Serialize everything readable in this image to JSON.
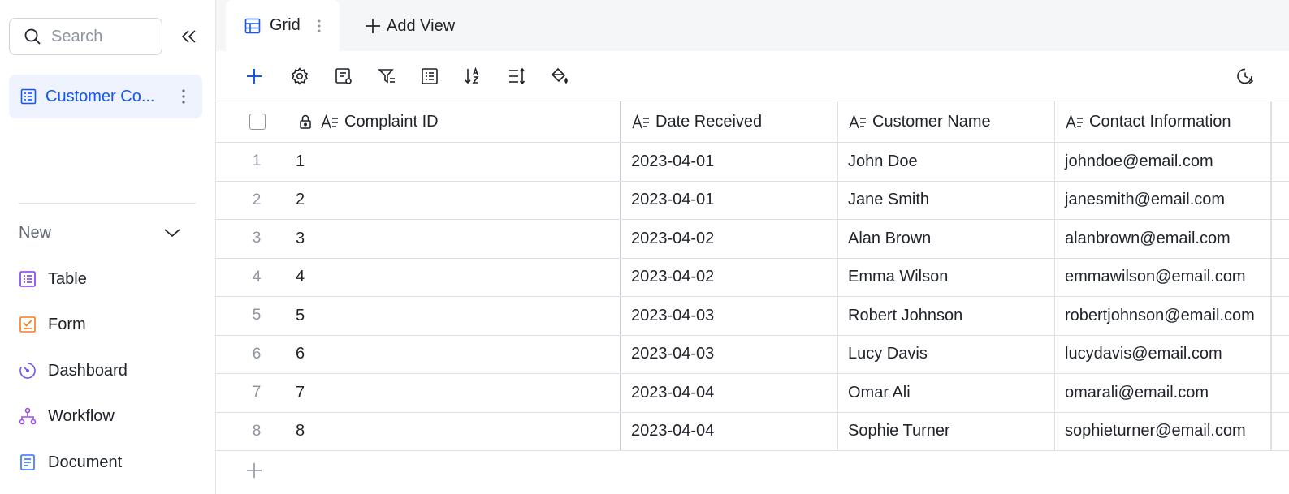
{
  "sidebar": {
    "search_placeholder": "Search",
    "active_item": "Customer Co...",
    "new_label": "New",
    "nav": [
      {
        "label": "Table",
        "icon": "table-icon",
        "color": "#7f3bf5"
      },
      {
        "label": "Form",
        "icon": "form-icon",
        "color": "#f57a1e"
      },
      {
        "label": "Dashboard",
        "icon": "dashboard-icon",
        "color": "#6c5ae8"
      },
      {
        "label": "Workflow",
        "icon": "workflow-icon",
        "color": "#9b4ae6"
      },
      {
        "label": "Document",
        "icon": "document-icon",
        "color": "#3370ff"
      }
    ]
  },
  "tabs": {
    "grid_label": "Grid",
    "add_view_label": "Add View"
  },
  "columns": [
    "Complaint ID",
    "Date Received",
    "Customer Name",
    "Contact Information"
  ],
  "rows": [
    {
      "num": "1",
      "id": "1",
      "date": "2023-04-01",
      "name": "John Doe",
      "contact": "johndoe@email.com"
    },
    {
      "num": "2",
      "id": "2",
      "date": "2023-04-01",
      "name": "Jane Smith",
      "contact": "janesmith@email.com"
    },
    {
      "num": "3",
      "id": "3",
      "date": "2023-04-02",
      "name": "Alan Brown",
      "contact": "alanbrown@email.com"
    },
    {
      "num": "4",
      "id": "4",
      "date": "2023-04-02",
      "name": "Emma Wilson",
      "contact": "emmawilson@email.com"
    },
    {
      "num": "5",
      "id": "5",
      "date": "2023-04-03",
      "name": "Robert Johnson",
      "contact": "robertjohnson@email.com"
    },
    {
      "num": "6",
      "id": "6",
      "date": "2023-04-03",
      "name": "Lucy Davis",
      "contact": "lucydavis@email.com"
    },
    {
      "num": "7",
      "id": "7",
      "date": "2023-04-04",
      "name": "Omar Ali",
      "contact": "omarali@email.com"
    },
    {
      "num": "8",
      "id": "8",
      "date": "2023-04-04",
      "name": "Sophie Turner",
      "contact": "sophieturner@email.com"
    }
  ],
  "colors": {
    "accent": "#1456f0",
    "active_bg": "#eef3fe",
    "text": "#1f2329",
    "muted": "#8f959e"
  }
}
